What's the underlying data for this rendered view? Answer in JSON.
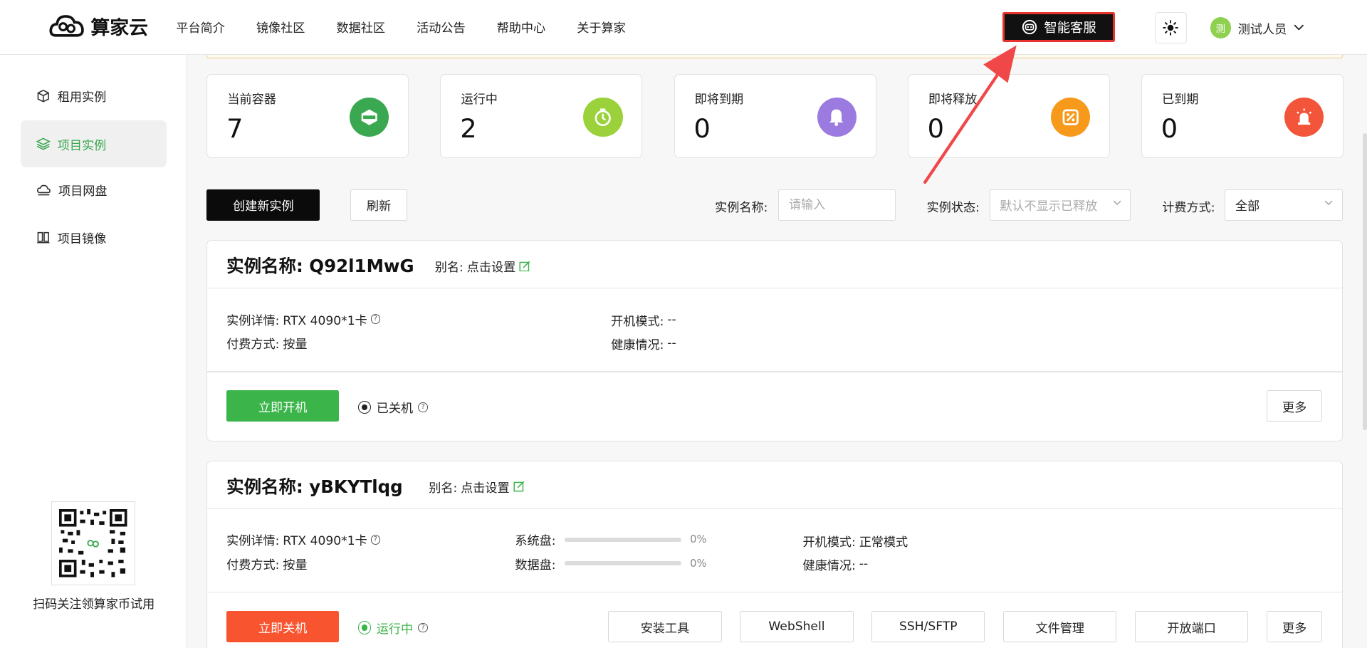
{
  "header": {
    "logo_text": "算家云",
    "nav": [
      "平台简介",
      "镜像社区",
      "数据社区",
      "活动公告",
      "帮助中心",
      "关于算家"
    ],
    "ai_service": "智能客服",
    "user_avatar": "测",
    "user_name": "测试人员"
  },
  "sidebar": {
    "items": [
      {
        "label": "租用实例",
        "icon": "cube-icon"
      },
      {
        "label": "项目实例",
        "icon": "layers-icon"
      },
      {
        "label": "项目网盘",
        "icon": "cloud-drive-icon"
      },
      {
        "label": "项目镜像",
        "icon": "image-stack-icon"
      }
    ],
    "qr_caption": "扫码关注领算家币试用"
  },
  "stats": [
    {
      "label": "当前容器",
      "value": "7",
      "color": "#3aa850",
      "icon": "container-icon"
    },
    {
      "label": "运行中",
      "value": "2",
      "color": "#9bd23c",
      "icon": "timer-icon"
    },
    {
      "label": "即将到期",
      "value": "0",
      "color": "#9b7be0",
      "icon": "bell-icon"
    },
    {
      "label": "即将释放",
      "value": "0",
      "color": "#f79a1b",
      "icon": "release-icon"
    },
    {
      "label": "已到期",
      "value": "0",
      "color": "#f2553a",
      "icon": "alarm-icon"
    }
  ],
  "toolbar": {
    "create": "创建新实例",
    "refresh": "刷新",
    "name_label": "实例名称:",
    "name_placeholder": "请输入",
    "status_label": "实例状态:",
    "status_placeholder": "默认不显示已释放",
    "billing_label": "计费方式:",
    "billing_value": "全部"
  },
  "instances": [
    {
      "title": "实例名称:  Q92l1MwG",
      "alias_label": "别名:",
      "alias_value": "点击设置",
      "detail_label": "实例详情:",
      "detail_value": "RTX 4090*1卡",
      "pay_label": "付费方式:",
      "pay_value": "按量",
      "boot_label": "开机模式:",
      "boot_value": "--",
      "health_label": "健康情况:",
      "health_value": "--",
      "action": "立即开机",
      "status": "已关机",
      "more": "更多"
    },
    {
      "title": "实例名称:  yBKYTlqg",
      "alias_label": "别名:",
      "alias_value": "点击设置",
      "detail_label": "实例详情:",
      "detail_value": "RTX 4090*1卡",
      "pay_label": "付费方式:",
      "pay_value": "按量",
      "sys_disk_label": "系统盘:",
      "sys_disk_value": "0%",
      "data_disk_label": "数据盘:",
      "data_disk_value": "0%",
      "boot_label": "开机模式:",
      "boot_value": "正常模式",
      "health_label": "健康情况:",
      "health_value": "--",
      "action": "立即关机",
      "status": "运行中",
      "tools": [
        "安装工具",
        "WebShell",
        "SSH/SFTP",
        "文件管理",
        "开放端口"
      ],
      "more": "更多"
    }
  ],
  "colors": {
    "brand_green": "#3bb44a",
    "danger": "#f7542f",
    "highlight_red": "#e8342f"
  }
}
